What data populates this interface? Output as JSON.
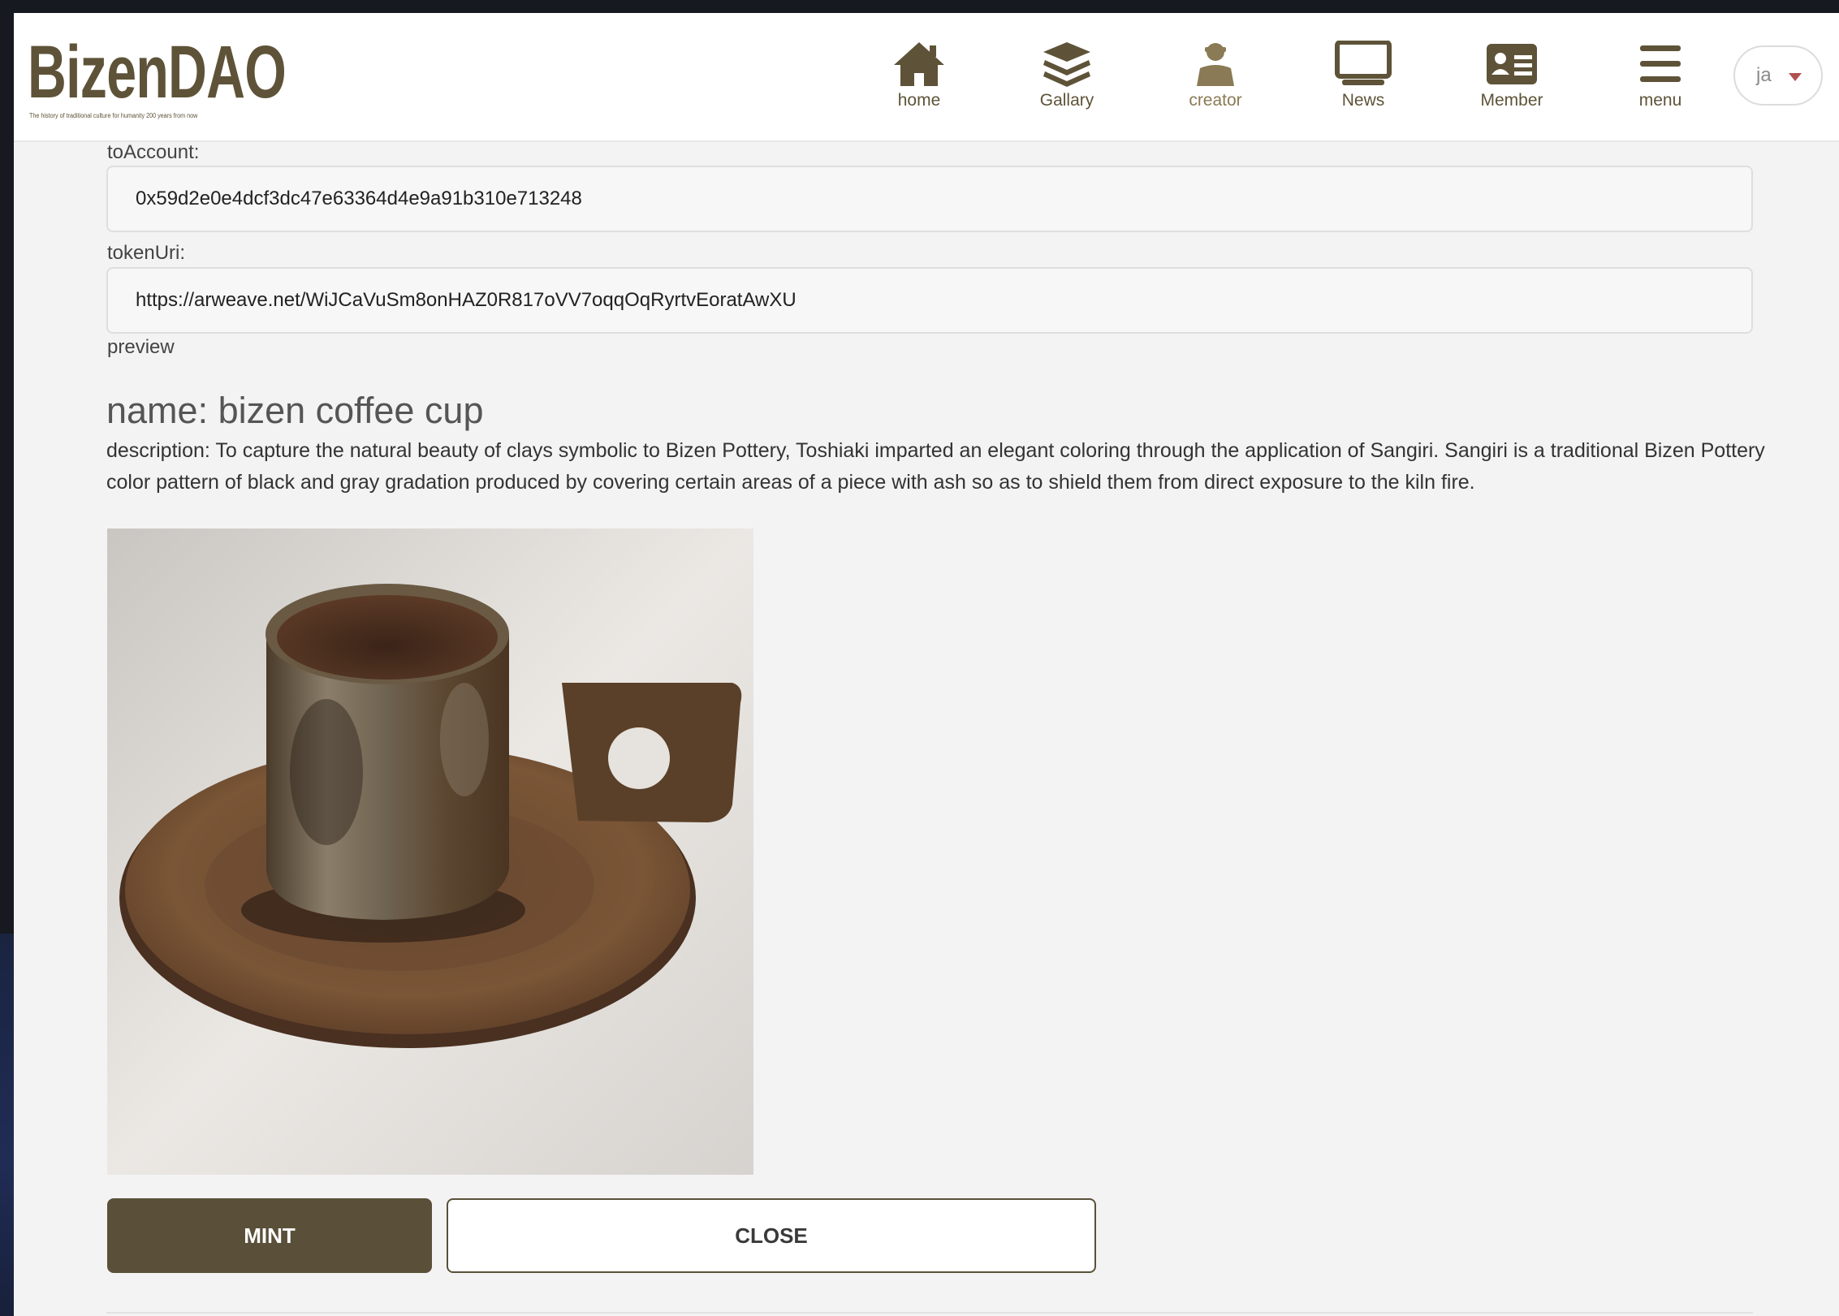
{
  "app": {
    "logo_title": "BizenDAO",
    "logo_tagline": "The history of traditional culture for humanity 200 years from now"
  },
  "nav": {
    "items": [
      {
        "label": "home",
        "icon": "home-icon"
      },
      {
        "label": "Gallary",
        "icon": "layers-icon"
      },
      {
        "label": "creator",
        "icon": "creator-icon"
      },
      {
        "label": "News",
        "icon": "monitor-icon"
      },
      {
        "label": "Member",
        "icon": "member-card-icon"
      },
      {
        "label": "menu",
        "icon": "hamburger-menu-icon"
      }
    ],
    "active": "creator"
  },
  "language": {
    "selected": "ja"
  },
  "form": {
    "to_account_label": "toAccount:",
    "to_account_value": "0x59d2e0e4dcf3dc47e63364d4e9a91b310e713248",
    "token_uri_label": "tokenUri:",
    "token_uri_value": "https://arweave.net/WiJCaVuSm8onHAZ0R817oVV7oqqOqRyrtvEoratAwXU"
  },
  "preview": {
    "label": "preview",
    "name": "name: bizen coffee cup",
    "description": "description: To capture the natural beauty of clays symbolic to Bizen Pottery, Toshiaki imparted an elegant coloring through the application of Sangiri. Sangiri is a traditional Bizen Pottery color pattern of black and gray gradation produced by covering certain areas of a piece with ash so as to shield them from direct exposure to the kiln fire."
  },
  "actions": {
    "mint_label": "MINT",
    "close_label": "CLOSE"
  },
  "colors": {
    "brand": "#5e5338",
    "button_dark": "#5a5039",
    "background": "#f3f3f3"
  }
}
